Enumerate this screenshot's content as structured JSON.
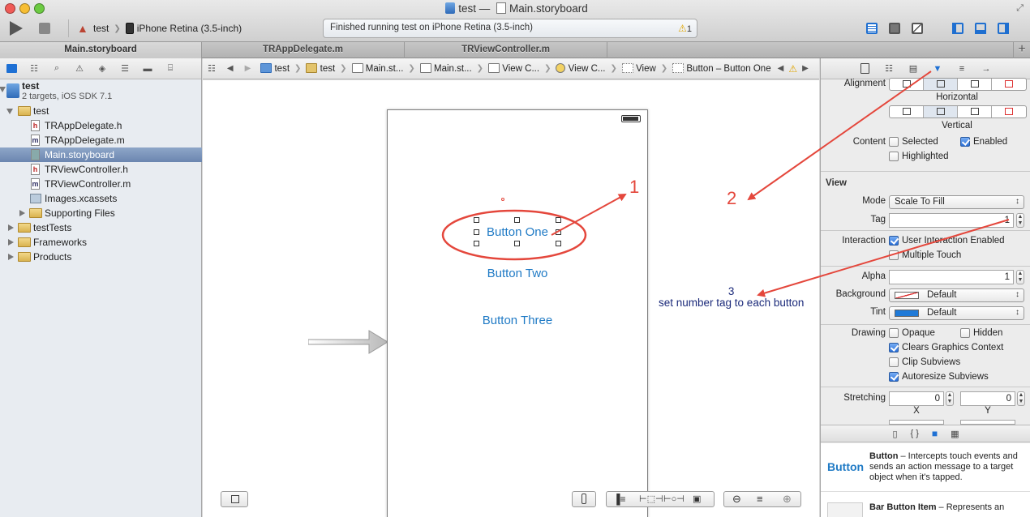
{
  "window": {
    "title_project": "test",
    "title_dash": "—",
    "title_file": "Main.storyboard"
  },
  "toolbar": {
    "scheme_target": "test",
    "scheme_device": "iPhone Retina (3.5-inch)",
    "activity_status": "Finished running test on iPhone Retina (3.5-inch)",
    "warning_count": "1"
  },
  "tabs": [
    {
      "label": "Main.storyboard",
      "active": true
    },
    {
      "label": "TRAppDelegate.m",
      "active": false
    },
    {
      "label": "TRViewController.m",
      "active": false
    }
  ],
  "navigator": {
    "project_name": "test",
    "project_subtitle": "2 targets, iOS SDK 7.1",
    "items": [
      {
        "label": "test",
        "kind": "folder",
        "expanded": true
      },
      {
        "label": "TRAppDelegate.h",
        "kind": "h"
      },
      {
        "label": "TRAppDelegate.m",
        "kind": "m"
      },
      {
        "label": "Main.storyboard",
        "kind": "storyboard",
        "selected": true
      },
      {
        "label": "TRViewController.h",
        "kind": "h"
      },
      {
        "label": "TRViewController.m",
        "kind": "m"
      },
      {
        "label": "Images.xcassets",
        "kind": "xcassets"
      },
      {
        "label": "Supporting Files",
        "kind": "folder",
        "expanded": false
      },
      {
        "label": "testTests",
        "kind": "folder",
        "expanded": false
      },
      {
        "label": "Frameworks",
        "kind": "folder",
        "expanded": false
      },
      {
        "label": "Products",
        "kind": "folder",
        "expanded": false
      }
    ]
  },
  "jumpbar": {
    "crumbs": [
      "test",
      "test",
      "Main.st...",
      "Main.st...",
      "View C...",
      "View C...",
      "View",
      "Button – Button One"
    ]
  },
  "canvas": {
    "buttons": [
      "Button One",
      "Button Two",
      "Button Three"
    ]
  },
  "annotations": {
    "num1": "1",
    "num2": "2",
    "num3": "3",
    "note": "set number tag to each button",
    "color": "#e4473c",
    "note_color": "#1b2a7a"
  },
  "inspector": {
    "alignment_label": "Alignment",
    "horizontal_label": "Horizontal",
    "vertical_label": "Vertical",
    "content_label": "Content",
    "selected_label": "Selected",
    "selected_checked": false,
    "enabled_label": "Enabled",
    "enabled_checked": true,
    "highlighted_label": "Highlighted",
    "highlighted_checked": false,
    "view_section": "View",
    "mode_label": "Mode",
    "mode_value": "Scale To Fill",
    "tag_label": "Tag",
    "tag_value": "1",
    "interaction_label": "Interaction",
    "user_interaction_label": "User Interaction Enabled",
    "multiple_touch_label": "Multiple Touch",
    "alpha_label": "Alpha",
    "alpha_value": "1",
    "background_label": "Background",
    "background_value": "Default",
    "tint_label": "Tint",
    "tint_value": "Default",
    "tint_color": "#1f7ad8",
    "drawing_label": "Drawing",
    "opaque_label": "Opaque",
    "hidden_label": "Hidden",
    "clears_label": "Clears Graphics Context",
    "clip_label": "Clip Subviews",
    "autoresize_label": "Autoresize Subviews",
    "stretching_label": "Stretching",
    "stretch_x": "0",
    "stretch_y": "0",
    "x_label": "X",
    "y_label": "Y"
  },
  "library": {
    "item1_name": "Button",
    "item1_title": "Button",
    "item1_desc": " – Intercepts touch events and sends an action message to a target object when it's tapped.",
    "item2_title": "Bar Button Item",
    "item2_desc": " – Represents an"
  }
}
